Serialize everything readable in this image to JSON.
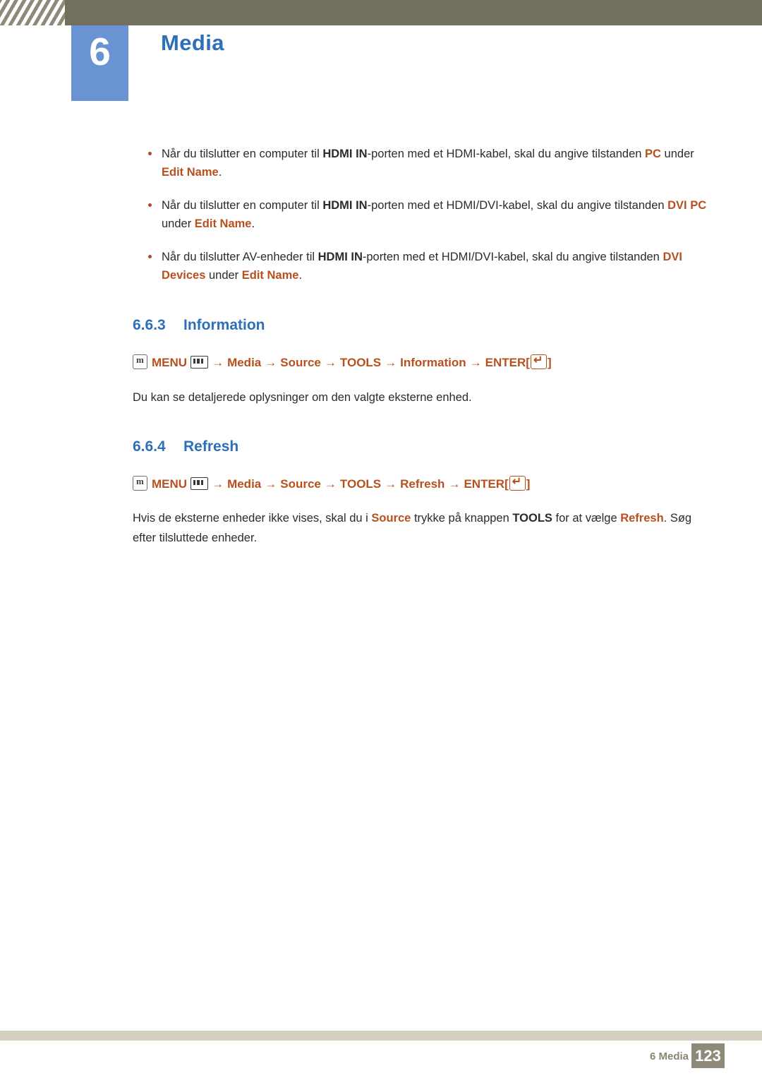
{
  "header": {
    "chapter_number": "6",
    "chapter_title": "Media"
  },
  "bullets": [
    {
      "parts": [
        {
          "t": "Når du tilslutter en computer til ",
          "s": "normal"
        },
        {
          "t": "HDMI IN",
          "s": "bold"
        },
        {
          "t": "-porten med et HDMI-kabel, skal du angive tilstanden ",
          "s": "normal"
        },
        {
          "t": "PC",
          "s": "orange"
        },
        {
          "t": " under ",
          "s": "normal"
        },
        {
          "t": "Edit Name",
          "s": "orange"
        },
        {
          "t": ".",
          "s": "normal"
        }
      ]
    },
    {
      "parts": [
        {
          "t": "Når du tilslutter en computer til ",
          "s": "normal"
        },
        {
          "t": "HDMI IN",
          "s": "bold"
        },
        {
          "t": "-porten med et HDMI/DVI-kabel, skal du angive tilstanden ",
          "s": "normal"
        },
        {
          "t": "DVI PC",
          "s": "orange"
        },
        {
          "t": " under ",
          "s": "normal"
        },
        {
          "t": "Edit Name",
          "s": "orange"
        },
        {
          "t": ".",
          "s": "normal"
        }
      ]
    },
    {
      "parts": [
        {
          "t": "Når du tilslutter AV-enheder til ",
          "s": "normal"
        },
        {
          "t": "HDMI IN",
          "s": "bold"
        },
        {
          "t": "-porten med et HDMI/DVI-kabel, skal du angive tilstanden ",
          "s": "normal"
        },
        {
          "t": "DVI Devices",
          "s": "orange"
        },
        {
          "t": " under ",
          "s": "normal"
        },
        {
          "t": "Edit Name",
          "s": "orange"
        },
        {
          "t": ".",
          "s": "normal"
        }
      ]
    }
  ],
  "sections": [
    {
      "number": "6.6.3",
      "title": "Information",
      "menupath": {
        "menu_label": "MENU",
        "steps": [
          "Media",
          "Source",
          "TOOLS",
          "Information"
        ],
        "enter_label": "ENTER",
        "bracket_open": "[",
        "bracket_close": "]",
        "arrow": "→"
      },
      "body": "Du kan se detaljerede oplysninger om den valgte eksterne enhed."
    },
    {
      "number": "6.6.4",
      "title": "Refresh",
      "menupath": {
        "menu_label": "MENU",
        "steps": [
          "Media",
          "Source",
          "TOOLS",
          "Refresh"
        ],
        "enter_label": "ENTER",
        "bracket_open": "[",
        "bracket_close": "]",
        "arrow": "→"
      },
      "body_parts": [
        {
          "t": "Hvis de eksterne enheder ikke vises, skal du i ",
          "s": "normal"
        },
        {
          "t": "Source",
          "s": "orange"
        },
        {
          "t": " trykke på knappen ",
          "s": "normal"
        },
        {
          "t": "TOOLS",
          "s": "bold"
        },
        {
          "t": " for at vælge ",
          "s": "normal"
        },
        {
          "t": "Refresh",
          "s": "orange"
        },
        {
          "t": ". Søg efter tilsluttede enheder.",
          "s": "normal"
        }
      ]
    }
  ],
  "footer": {
    "label": "6 Media",
    "page": "123"
  },
  "colors": {
    "header_bar": "#736f5e",
    "chapter_badge": "#6a93d4",
    "heading_blue": "#2e6fba",
    "accent_orange": "#b8501e",
    "footer_rule": "#d5cfc0",
    "footer_page_bg": "#8d8a7a"
  }
}
